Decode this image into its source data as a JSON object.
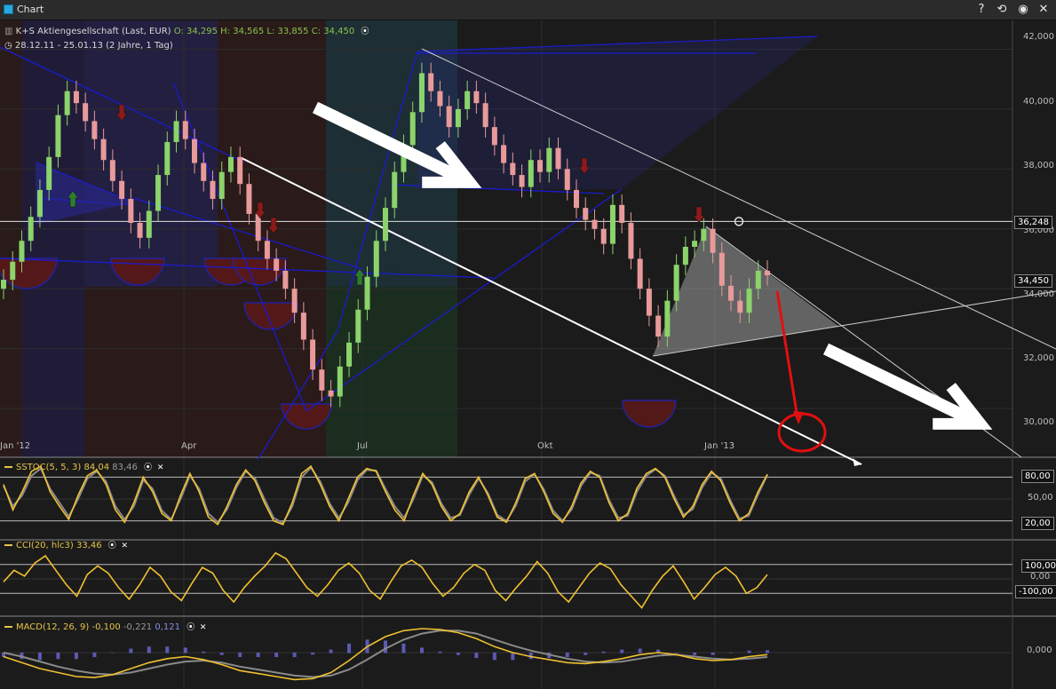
{
  "window": {
    "title": "Chart",
    "buttons": [
      {
        "name": "help-button",
        "glyph": "?"
      },
      {
        "name": "reset-view-button",
        "glyph": "⟲"
      },
      {
        "name": "record-button",
        "glyph": "◉"
      },
      {
        "name": "close-button",
        "glyph": "✕"
      }
    ]
  },
  "header": {
    "instrument": "K+S Aktiengesellschaft (Last, EUR)",
    "open": "O: 34,295",
    "high": "H: 34,565",
    "low": "L: 33,855",
    "close": "C: 34,450",
    "range": "28.12.11 - 25.01.13 (2 Jahre, 1 Tag)"
  },
  "colors": {
    "up": "#8bd36b",
    "down": "#e89a9a",
    "indicator": "#f0c030",
    "signal": "#8a8a8a",
    "trend_blue": "#1a1ad0",
    "annotation_red": "#e01010"
  },
  "chart_data": [
    {
      "type": "candlestick",
      "title": "",
      "x_ticks": [
        "Jan '12",
        "Apr",
        "Jul",
        "Okt",
        "Jan '13"
      ],
      "y_ticks": [
        "42,000",
        "40,000",
        "38,000",
        "36,000",
        "34,000",
        "32,000",
        "30,000"
      ],
      "ylim": [
        29.2,
        42.4
      ],
      "price_labels": [
        "36,248",
        "34,450"
      ],
      "last_close": 34.45,
      "horizontal_line": 36.248,
      "closes": [
        34.3,
        34.9,
        35.6,
        36.4,
        37.3,
        38.4,
        39.8,
        40.6,
        40.2,
        39.6,
        39.0,
        38.3,
        37.6,
        37.0,
        36.2,
        35.7,
        36.6,
        37.8,
        38.9,
        39.6,
        39.0,
        38.2,
        37.6,
        37.0,
        37.9,
        38.4,
        37.5,
        36.5,
        35.6,
        35.0,
        34.6,
        34.0,
        33.2,
        32.3,
        31.3,
        30.6,
        30.4,
        31.4,
        32.2,
        33.3,
        34.4,
        35.6,
        36.7,
        37.9,
        38.8,
        39.9,
        41.2,
        40.6,
        40.1,
        39.4,
        40.0,
        40.6,
        40.2,
        39.4,
        38.8,
        38.2,
        37.8,
        37.4,
        38.3,
        37.9,
        38.7,
        38.0,
        37.3,
        36.7,
        36.3,
        36.0,
        35.5,
        36.8,
        36.2,
        35.0,
        34.0,
        33.1,
        32.4,
        33.6,
        34.8,
        35.4,
        35.6,
        36.0,
        35.2,
        34.1,
        33.6,
        33.2,
        34.0,
        34.6,
        34.45
      ]
    },
    {
      "type": "line",
      "title": "SSTOC(5, 5, 3)",
      "values_label": "84,04",
      "signal_label": "83,46",
      "levels": [
        "80,00",
        "50,00",
        "20,00"
      ],
      "ylim": [
        0,
        100
      ],
      "series": [
        {
          "name": "SSTOC",
          "values": [
            70,
            35,
            60,
            88,
            95,
            60,
            40,
            22,
            55,
            82,
            90,
            70,
            35,
            18,
            45,
            80,
            60,
            30,
            20,
            55,
            85,
            60,
            25,
            15,
            40,
            70,
            90,
            75,
            45,
            20,
            15,
            45,
            85,
            95,
            70,
            40,
            20,
            50,
            80,
            92,
            88,
            60,
            35,
            20,
            55,
            85,
            70,
            40,
            20,
            30,
            60,
            80,
            55,
            25,
            18,
            45,
            78,
            85,
            60,
            30,
            18,
            40,
            72,
            88,
            80,
            45,
            20,
            30,
            65,
            85,
            92,
            80,
            50,
            25,
            40,
            70,
            88,
            75,
            45,
            20,
            30,
            60,
            84
          ]
        },
        {
          "name": "Signal",
          "values": [
            68,
            40,
            55,
            82,
            92,
            64,
            45,
            26,
            50,
            78,
            88,
            74,
            40,
            22,
            40,
            76,
            64,
            34,
            22,
            50,
            82,
            64,
            30,
            18,
            36,
            66,
            88,
            78,
            50,
            24,
            17,
            40,
            80,
            93,
            74,
            44,
            24,
            45,
            76,
            90,
            89,
            64,
            40,
            24,
            50,
            82,
            73,
            44,
            24,
            28,
            56,
            78,
            58,
            28,
            20,
            41,
            74,
            84,
            63,
            34,
            20,
            36,
            68,
            86,
            82,
            49,
            24,
            27,
            60,
            82,
            91,
            82,
            54,
            28,
            36,
            66,
            86,
            78,
            49,
            23,
            27,
            56,
            83
          ]
        }
      ]
    },
    {
      "type": "line",
      "title": "CCI(20, hlc3)",
      "values_label": "33,46",
      "levels": [
        "100,00",
        "0,00",
        "-100,00"
      ],
      "ylim": [
        -240,
        240
      ],
      "series": [
        {
          "name": "CCI",
          "values": [
            -20,
            60,
            20,
            110,
            160,
            60,
            -40,
            -120,
            30,
            90,
            40,
            -60,
            -140,
            -40,
            80,
            20,
            -90,
            -150,
            -30,
            80,
            40,
            -80,
            -160,
            -60,
            20,
            90,
            180,
            140,
            40,
            -60,
            -120,
            -40,
            60,
            110,
            40,
            -80,
            -140,
            -20,
            90,
            130,
            80,
            -30,
            -120,
            -60,
            40,
            100,
            60,
            -80,
            -150,
            -60,
            20,
            120,
            40,
            -90,
            -160,
            -60,
            40,
            110,
            70,
            -40,
            -120,
            -200,
            -80,
            20,
            90,
            -20,
            -140,
            -60,
            30,
            80,
            20,
            -100,
            -60,
            30
          ]
        }
      ]
    },
    {
      "type": "line",
      "title": "MACD(12, 26, 9)",
      "values_label": "-0,100",
      "signal_label": "-0,221",
      "hist_label": "0,121",
      "levels": [
        "0,000"
      ],
      "ylim": [
        -1.6,
        1.6
      ],
      "series": [
        {
          "name": "MACD",
          "values": [
            -0.2,
            -0.5,
            -0.8,
            -1.0,
            -1.2,
            -1.25,
            -1.1,
            -0.8,
            -0.5,
            -0.3,
            -0.2,
            -0.35,
            -0.6,
            -0.9,
            -1.05,
            -1.2,
            -1.35,
            -1.3,
            -1.0,
            -0.4,
            0.3,
            0.8,
            1.1,
            1.2,
            1.15,
            1.0,
            0.7,
            0.3,
            0.0,
            -0.2,
            -0.35,
            -0.5,
            -0.55,
            -0.45,
            -0.3,
            -0.1,
            0.0,
            -0.1,
            -0.3,
            -0.4,
            -0.35,
            -0.2,
            -0.1
          ]
        },
        {
          "name": "Signal",
          "values": [
            0.0,
            -0.2,
            -0.45,
            -0.7,
            -0.9,
            -1.05,
            -1.1,
            -1.0,
            -0.8,
            -0.6,
            -0.45,
            -0.4,
            -0.5,
            -0.7,
            -0.85,
            -1.0,
            -1.15,
            -1.22,
            -1.15,
            -0.85,
            -0.35,
            0.2,
            0.65,
            0.95,
            1.1,
            1.1,
            0.95,
            0.65,
            0.35,
            0.1,
            -0.1,
            -0.3,
            -0.45,
            -0.5,
            -0.45,
            -0.3,
            -0.15,
            -0.1,
            -0.2,
            -0.3,
            -0.35,
            -0.3,
            -0.22
          ]
        }
      ]
    }
  ]
}
